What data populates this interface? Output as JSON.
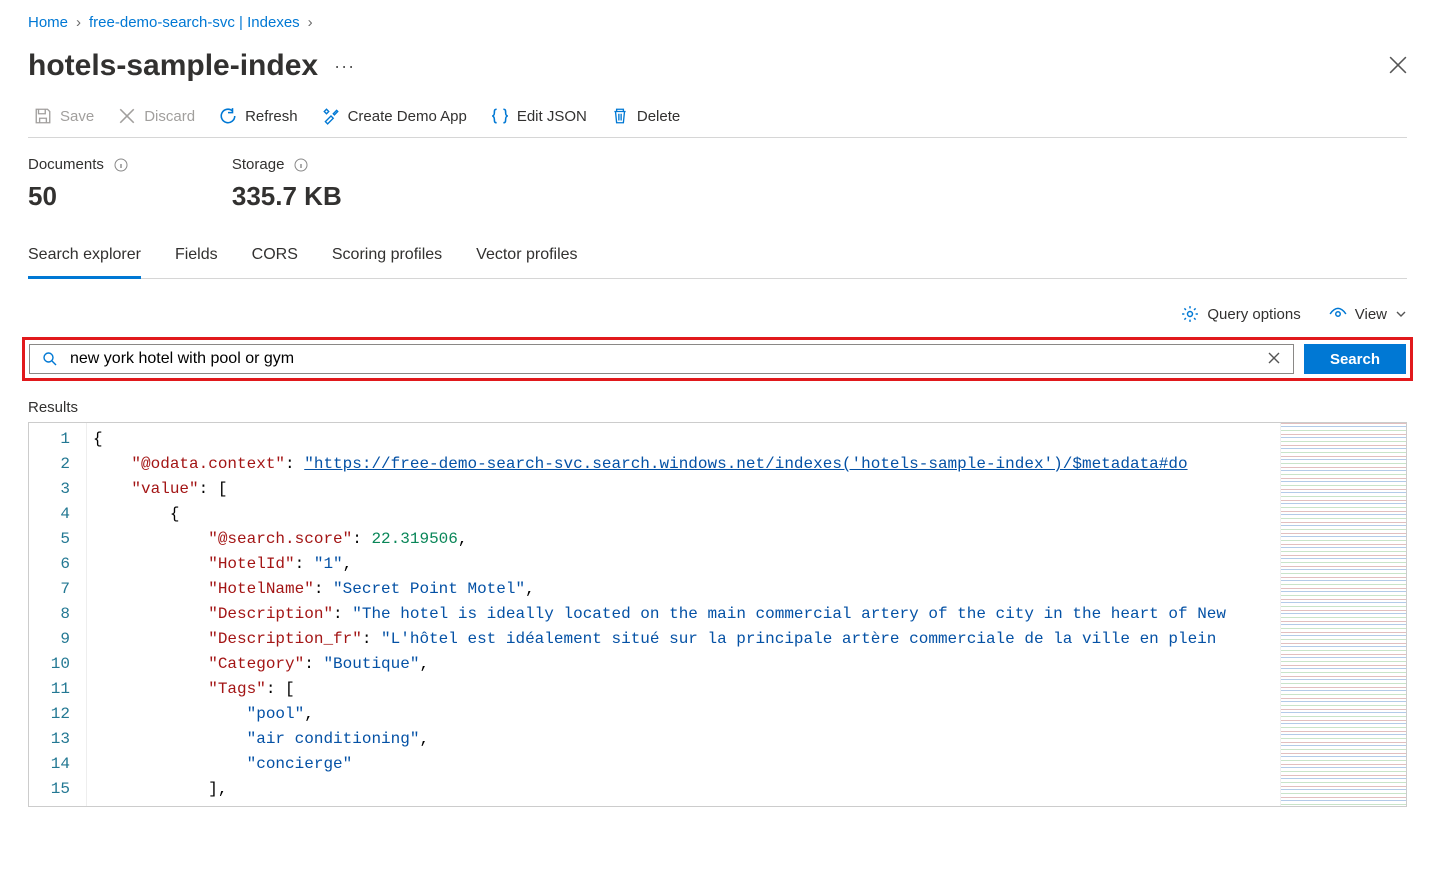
{
  "breadcrumb": {
    "home": "Home",
    "service": "free-demo-search-svc | Indexes"
  },
  "page_title": "hotels-sample-index",
  "toolbar": {
    "save": "Save",
    "discard": "Discard",
    "refresh": "Refresh",
    "create_demo": "Create Demo App",
    "edit_json": "Edit JSON",
    "delete": "Delete"
  },
  "stats": {
    "documents_label": "Documents",
    "documents_value": "50",
    "storage_label": "Storage",
    "storage_value": "335.7 KB"
  },
  "tabs": [
    "Search explorer",
    "Fields",
    "CORS",
    "Scoring profiles",
    "Vector profiles"
  ],
  "active_tab": 0,
  "options": {
    "query_options": "Query options",
    "view": "View"
  },
  "search": {
    "value": "new york hotel with pool or gym",
    "button": "Search"
  },
  "results_label": "Results",
  "code_lines": [
    [
      [
        "pun",
        "{"
      ]
    ],
    [
      [
        "pun",
        "    "
      ],
      [
        "key",
        "\"@odata.context\""
      ],
      [
        "pun",
        ": "
      ],
      [
        "url",
        "\"https://free-demo-search-svc.search.windows.net/indexes('hotels-sample-index')/$metadata#do"
      ]
    ],
    [
      [
        "pun",
        "    "
      ],
      [
        "key",
        "\"value\""
      ],
      [
        "pun",
        ": ["
      ]
    ],
    [
      [
        "pun",
        "        {"
      ]
    ],
    [
      [
        "pun",
        "            "
      ],
      [
        "key",
        "\"@search.score\""
      ],
      [
        "pun",
        ": "
      ],
      [
        "num",
        "22.319506"
      ],
      [
        "pun",
        ","
      ]
    ],
    [
      [
        "pun",
        "            "
      ],
      [
        "key",
        "\"HotelId\""
      ],
      [
        "pun",
        ": "
      ],
      [
        "str",
        "\"1\""
      ],
      [
        "pun",
        ","
      ]
    ],
    [
      [
        "pun",
        "            "
      ],
      [
        "key",
        "\"HotelName\""
      ],
      [
        "pun",
        ": "
      ],
      [
        "str",
        "\"Secret Point Motel\""
      ],
      [
        "pun",
        ","
      ]
    ],
    [
      [
        "pun",
        "            "
      ],
      [
        "key",
        "\"Description\""
      ],
      [
        "pun",
        ": "
      ],
      [
        "str",
        "\"The hotel is ideally located on the main commercial artery of the city in the heart of New"
      ]
    ],
    [
      [
        "pun",
        "            "
      ],
      [
        "key",
        "\"Description_fr\""
      ],
      [
        "pun",
        ": "
      ],
      [
        "str",
        "\"L'hôtel est idéalement situé sur la principale artère commerciale de la ville en plein"
      ]
    ],
    [
      [
        "pun",
        "            "
      ],
      [
        "key",
        "\"Category\""
      ],
      [
        "pun",
        ": "
      ],
      [
        "str",
        "\"Boutique\""
      ],
      [
        "pun",
        ","
      ]
    ],
    [
      [
        "pun",
        "            "
      ],
      [
        "key",
        "\"Tags\""
      ],
      [
        "pun",
        ": ["
      ]
    ],
    [
      [
        "pun",
        "                "
      ],
      [
        "str",
        "\"pool\""
      ],
      [
        "pun",
        ","
      ]
    ],
    [
      [
        "pun",
        "                "
      ],
      [
        "str",
        "\"air conditioning\""
      ],
      [
        "pun",
        ","
      ]
    ],
    [
      [
        "pun",
        "                "
      ],
      [
        "str",
        "\"concierge\""
      ]
    ],
    [
      [
        "pun",
        "            ],"
      ]
    ]
  ]
}
